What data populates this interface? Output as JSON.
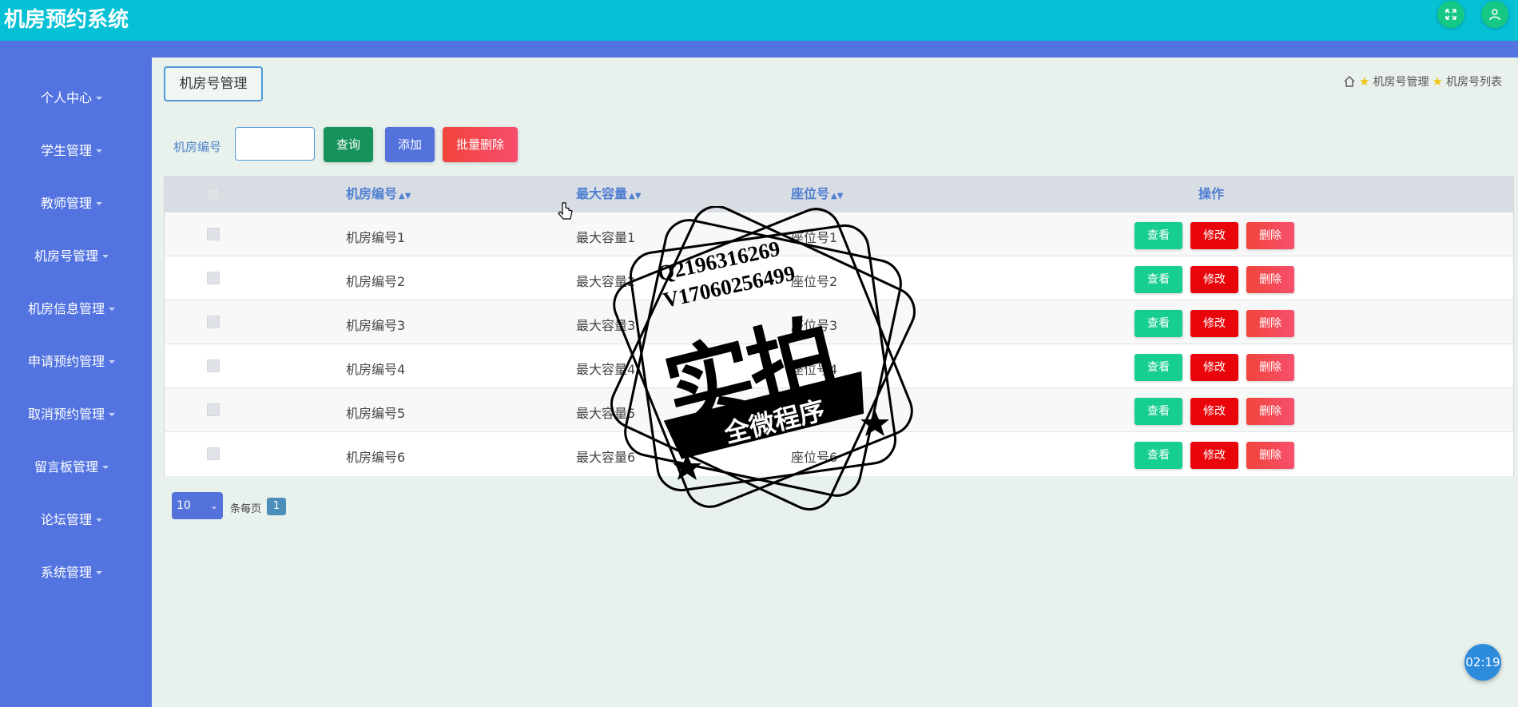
{
  "header": {
    "title": "机房预约系统"
  },
  "sidebar": {
    "items": [
      {
        "label": "个人中心"
      },
      {
        "label": "学生管理"
      },
      {
        "label": "教师管理"
      },
      {
        "label": "机房号管理"
      },
      {
        "label": "机房信息管理"
      },
      {
        "label": "申请预约管理"
      },
      {
        "label": "取消预约管理"
      },
      {
        "label": "留言板管理"
      },
      {
        "label": "论坛管理"
      },
      {
        "label": "系统管理"
      }
    ]
  },
  "page": {
    "title": "机房号管理",
    "breadcrumb": [
      "机房号管理",
      "机房号列表"
    ]
  },
  "search": {
    "label": "机房编号",
    "value": "",
    "query_button": "查询",
    "add_button": "添加",
    "batch_delete_button": "批量删除"
  },
  "table": {
    "columns": [
      "机房编号",
      "最大容量",
      "座位号",
      "操作"
    ],
    "rows": [
      {
        "room_no": "机房编号1",
        "capacity": "最大容量1",
        "seat_no": "座位号1"
      },
      {
        "room_no": "机房编号2",
        "capacity": "最大容量2",
        "seat_no": "座位号2"
      },
      {
        "room_no": "机房编号3",
        "capacity": "最大容量3",
        "seat_no": "座位号3"
      },
      {
        "room_no": "机房编号4",
        "capacity": "最大容量4",
        "seat_no": "座位号4"
      },
      {
        "room_no": "机房编号5",
        "capacity": "最大容量5",
        "seat_no": "座位号5"
      },
      {
        "room_no": "机房编号6",
        "capacity": "最大容量6",
        "seat_no": "座位号6"
      }
    ],
    "actions": {
      "view": "查看",
      "edit": "修改",
      "delete": "删除"
    }
  },
  "pagination": {
    "page_size": "10",
    "per_page_label": "条每页",
    "current_page": "1"
  },
  "timer": "02:19",
  "watermark": {
    "line1": "Q2196316269",
    "line2": "V17060256499",
    "main": "实拍",
    "ribbon": "全微程序"
  }
}
